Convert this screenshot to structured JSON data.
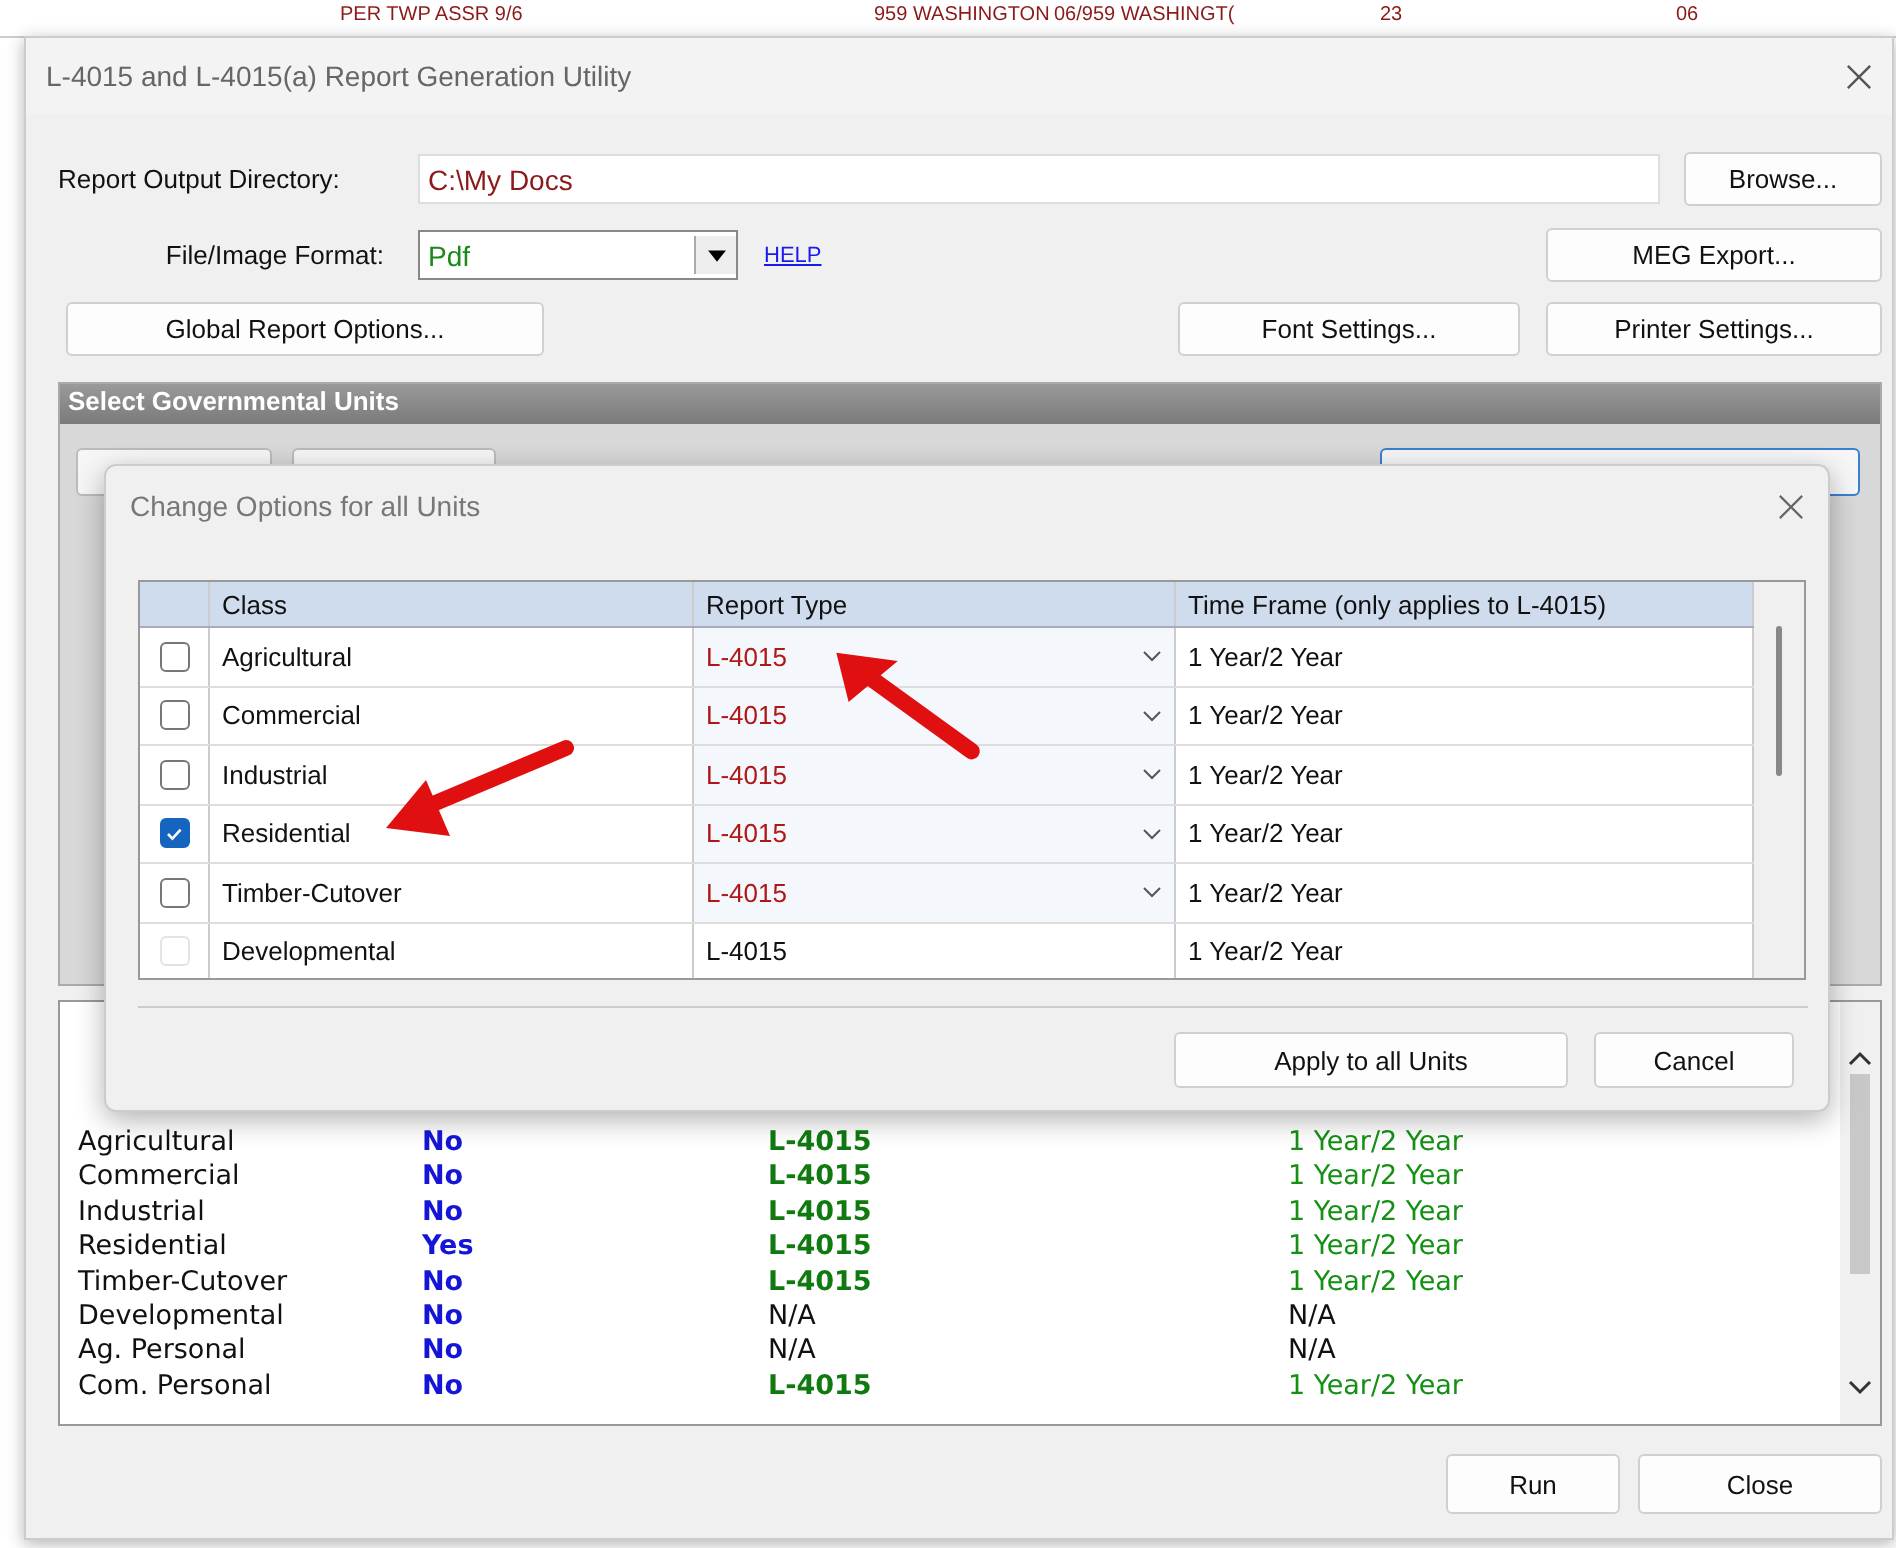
{
  "background_sheet": {
    "cells": [
      "PER TWP ASSR 9/6",
      "959 WASHINGTON",
      "06/959 WASHINGT(",
      "23",
      "06"
    ]
  },
  "window": {
    "title": "L-4015 and L-4015(a) Report Generation Utility",
    "output_directory": {
      "label": "Report Output Directory:",
      "value": "C:\\My Docs",
      "button": "Browse..."
    },
    "format": {
      "label": "File/Image Format:",
      "value": "Pdf",
      "help": "HELP",
      "button": "MEG Export..."
    },
    "buttons_row": [
      "Global Report Options...",
      "Font Settings...",
      "Printer Settings..."
    ],
    "units_group": {
      "title": "Select Governmental Units"
    },
    "summary": [
      {
        "class": "Agricultural",
        "include": "No",
        "report_type": "L-4015",
        "time_frame": "1 Year/2 Year",
        "applicable": true
      },
      {
        "class": "Commercial",
        "include": "No",
        "report_type": "L-4015",
        "time_frame": "1 Year/2 Year",
        "applicable": true
      },
      {
        "class": "Industrial",
        "include": "No",
        "report_type": "L-4015",
        "time_frame": "1 Year/2 Year",
        "applicable": true
      },
      {
        "class": "Residential",
        "include": "Yes",
        "report_type": "L-4015",
        "time_frame": "1 Year/2 Year",
        "applicable": true
      },
      {
        "class": "Timber-Cutover",
        "include": "No",
        "report_type": "L-4015",
        "time_frame": "1 Year/2 Year",
        "applicable": true
      },
      {
        "class": "Developmental",
        "include": "No",
        "report_type": "N/A",
        "time_frame": "N/A",
        "applicable": false
      },
      {
        "class": "Ag. Personal",
        "include": "No",
        "report_type": "N/A",
        "time_frame": "N/A",
        "applicable": false
      },
      {
        "class": "Com. Personal",
        "include": "No",
        "report_type": "L-4015",
        "time_frame": "1 Year/2 Year",
        "applicable": true
      }
    ],
    "footer_buttons": [
      "Run",
      "Close"
    ]
  },
  "dialog": {
    "title": "Change Options for all Units",
    "columns": [
      "Class",
      "Report Type",
      "Time Frame (only applies to L-4015)"
    ],
    "rows": [
      {
        "checked": false,
        "enabled": true,
        "class": "Agricultural",
        "report_type": "L-4015",
        "time_frame": "1 Year/2 Year"
      },
      {
        "checked": false,
        "enabled": true,
        "class": "Commercial",
        "report_type": "L-4015",
        "time_frame": "1 Year/2 Year"
      },
      {
        "checked": false,
        "enabled": true,
        "class": "Industrial",
        "report_type": "L-4015",
        "time_frame": "1 Year/2 Year"
      },
      {
        "checked": true,
        "enabled": true,
        "class": "Residential",
        "report_type": "L-4015",
        "time_frame": "1 Year/2 Year"
      },
      {
        "checked": false,
        "enabled": true,
        "class": "Timber-Cutover",
        "report_type": "L-4015",
        "time_frame": "1 Year/2 Year"
      },
      {
        "checked": false,
        "enabled": false,
        "class": "Developmental",
        "report_type": "L-4015",
        "time_frame": "1 Year/2 Year"
      }
    ],
    "buttons": [
      "Apply to all Units",
      "Cancel"
    ]
  }
}
